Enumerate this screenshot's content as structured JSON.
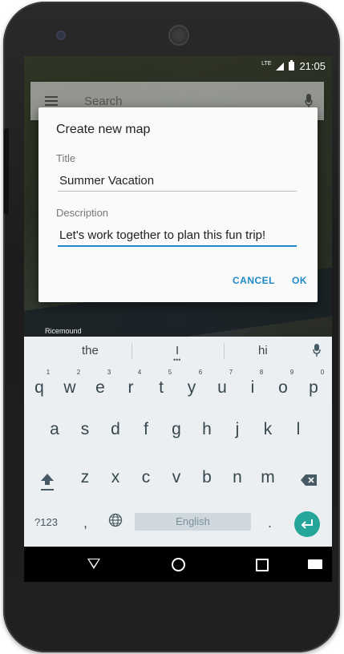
{
  "status_bar": {
    "network": "LTE",
    "time": "21:05"
  },
  "search_bar": {
    "placeholder": "Search"
  },
  "map": {
    "place_label": "Ricemound"
  },
  "dialog": {
    "title": "Create new map",
    "title_label": "Title",
    "title_value": "Summer Vacation",
    "description_label": "Description",
    "description_value": "Let's work together to plan this fun trip!",
    "cancel_label": "CANCEL",
    "ok_label": "OK"
  },
  "keyboard": {
    "suggestions": [
      "the",
      "I",
      "hi"
    ],
    "row1": [
      "q",
      "w",
      "e",
      "r",
      "t",
      "y",
      "u",
      "i",
      "o",
      "p"
    ],
    "row1_hints": [
      "1",
      "2",
      "3",
      "4",
      "5",
      "6",
      "7",
      "8",
      "9",
      "0"
    ],
    "row2": [
      "a",
      "s",
      "d",
      "f",
      "g",
      "h",
      "j",
      "k",
      "l"
    ],
    "row3": [
      "z",
      "x",
      "c",
      "v",
      "b",
      "n",
      "m"
    ],
    "symbols_label": "?123",
    "comma_label": ",",
    "period_label": ".",
    "space_label": "English"
  },
  "colors": {
    "accent": "#1e88c6",
    "enter_key": "#26a69a",
    "keyboard_bg": "#eceff1"
  }
}
